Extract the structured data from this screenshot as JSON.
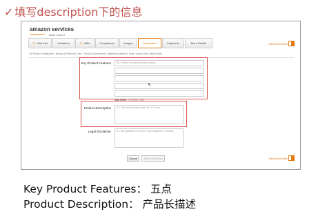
{
  "slide": {
    "title": "填写description下的信息",
    "captions": [
      "Key Product Features： 五点",
      "Product Description： 产品长描述"
    ]
  },
  "screenshot": {
    "logo": {
      "text": "amazon services",
      "sub": "seller central"
    },
    "tabs": [
      {
        "label": "Vital Info",
        "warning": true
      },
      {
        "label": "Variations",
        "warning": false
      },
      {
        "label": "Offer",
        "warning": true
      },
      {
        "label": "Compliance",
        "warning": false
      },
      {
        "label": "Images",
        "warning": false
      },
      {
        "label": "Description",
        "warning": false,
        "active": true
      },
      {
        "label": "Keywords",
        "warning": false
      },
      {
        "label": "More Details",
        "warning": false
      }
    ],
    "advanced_view": "Advanced View",
    "breadcrumb": "All Product Categories › Beauty & Personal Care › Tools & Accessories › Makeup Brushes & Tools › Brush Sets › Brush Sets",
    "fields": {
      "key_features": {
        "label": "Key Product Features",
        "placeholder": "Ex: Perfect for trimming dense grass"
      },
      "add_more": {
        "label": "Add More",
        "secondary": "Remove Last"
      },
      "description": {
        "label": "Product Description",
        "placeholder": "Ex: This ball has been rated for 10 users"
      },
      "legal": {
        "label": "Legal Disclaimer",
        "placeholder": "Ex: Not available in the US. Only available in Canada"
      }
    },
    "buttons": {
      "cancel": "Cancel",
      "save": "Save and finish"
    },
    "accent_color": "#e47911",
    "highlight_color": "#d9534f"
  }
}
